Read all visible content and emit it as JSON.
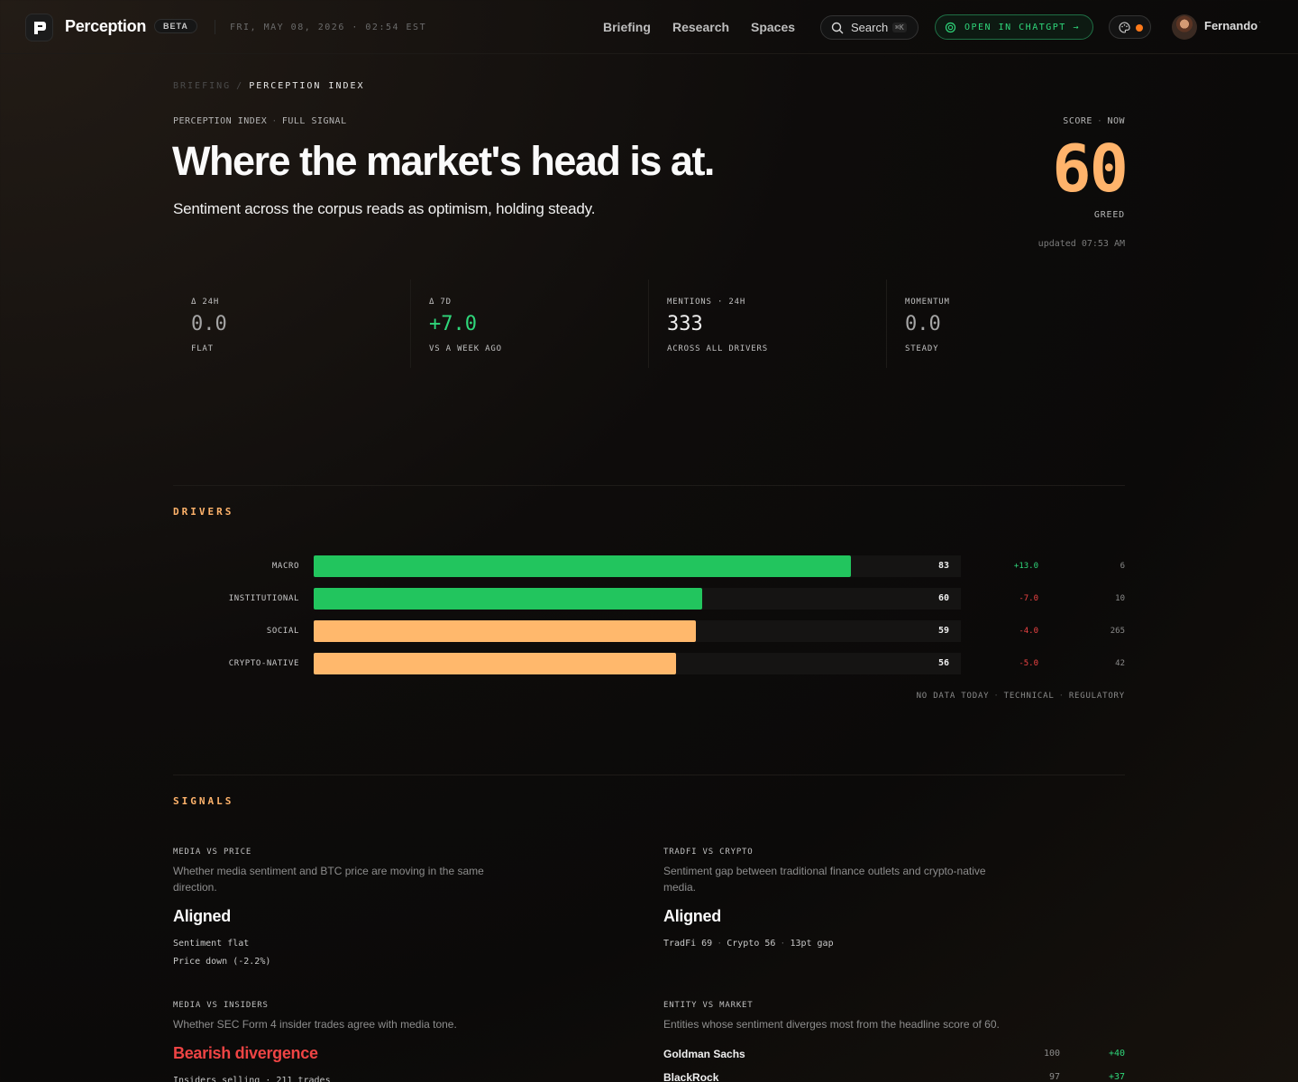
{
  "nav": {
    "brand": "Perception",
    "beta": "BETA",
    "datetime": "FRI, MAY 08, 2026 · 02:54 EST",
    "links": [
      "Briefing",
      "Research",
      "Spaces"
    ],
    "search_label": "Search",
    "search_shortcut": "⌘K",
    "chatgpt_label": "OPEN IN CHATGPT →",
    "user_name": "Fernando",
    "user_chevron": "·",
    "theme_dot_color": "#ff7a1a"
  },
  "breadcrumb": {
    "parent": "BRIEFING",
    "separator": "/",
    "current": "PERCEPTION INDEX"
  },
  "header": {
    "eyebrow_a": "PERCEPTION INDEX",
    "eyebrow_b": "FULL SIGNAL",
    "title": "Where the market's head is at.",
    "subtitle": "Sentiment across the corpus reads as optimism, holding steady.",
    "score_label_a": "SCORE",
    "score_label_b": "NOW",
    "score": "60",
    "score_word": "GREED",
    "updated": "updated 07:53 AM",
    "score_color": "#ffb36b"
  },
  "stats": [
    {
      "key": "Δ 24H",
      "value": "0.0",
      "sub": "FLAT",
      "tone": "neutral"
    },
    {
      "key": "Δ 7D",
      "value": "+7.0",
      "sub": "VS A WEEK AGO",
      "tone": "positive"
    },
    {
      "key": "MENTIONS · 24H",
      "value": "333",
      "sub": "ACROSS ALL DRIVERS",
      "tone": "bright"
    },
    {
      "key": "MOMENTUM",
      "value": "0.0",
      "sub": "STEADY",
      "tone": "neutral"
    }
  ],
  "drivers": {
    "title": "DRIVERS",
    "scale_max": 100,
    "rows": [
      {
        "name": "MACRO",
        "score": 83,
        "delta": "+13.0",
        "count": "6",
        "color": "#22c55e",
        "tone": "pos"
      },
      {
        "name": "INSTITUTIONAL",
        "score": 60,
        "delta": "-7.0",
        "count": "10",
        "color": "#22c55e",
        "tone": "neg"
      },
      {
        "name": "SOCIAL",
        "score": 59,
        "delta": "-4.0",
        "count": "265",
        "color": "#ffb86c",
        "tone": "neg"
      },
      {
        "name": "CRYPTO-NATIVE",
        "score": 56,
        "delta": "-5.0",
        "count": "42",
        "color": "#ffb86c",
        "tone": "neg"
      }
    ],
    "no_data": [
      "NO DATA TODAY",
      "TECHNICAL",
      "REGULATORY"
    ]
  },
  "signals": {
    "title": "SIGNALS",
    "media_vs_price": {
      "key": "MEDIA VS PRICE",
      "desc": "Whether media sentiment and BTC price are moving in the same direction.",
      "value": "Aligned",
      "line1": "Sentiment flat",
      "line2": "Price down (-2.2%)"
    },
    "tradfi_vs_crypto": {
      "key": "TRADFI VS CRYPTO",
      "desc": "Sentiment gap between traditional finance outlets and crypto-native media.",
      "value": "Aligned",
      "tradfi": "TradFi 69",
      "crypto": "Crypto 56",
      "gap": "13pt gap"
    },
    "media_vs_insiders": {
      "key": "MEDIA VS INSIDERS",
      "desc": "Whether SEC Form 4 insider trades agree with media tone.",
      "value": "Bearish divergence",
      "line1": "Insiders selling · 211 trades"
    },
    "entity_vs_market": {
      "key": "ENTITY VS MARKET",
      "desc": "Entities whose sentiment diverges most from the headline score of 60.",
      "entities": [
        {
          "name": "Goldman Sachs",
          "score": "100",
          "diff": "+40"
        },
        {
          "name": "BlackRock",
          "score": "97",
          "diff": "+37"
        }
      ]
    }
  }
}
